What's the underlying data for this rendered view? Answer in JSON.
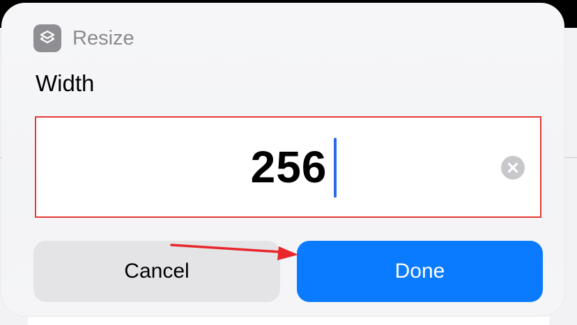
{
  "dialog": {
    "app_icon": "shortcuts-layers-icon",
    "app_name": "Resize",
    "field_title": "Width",
    "input_value": "256",
    "clear_icon": "clear-x-circle-icon",
    "cancel_label": "Cancel",
    "done_label": "Done"
  },
  "annotation": {
    "type": "red-arrow",
    "color": "#e8262b",
    "points_to": "done-button"
  },
  "colors": {
    "accent": "#0a7bff",
    "highlight_border": "#e53935",
    "caret": "#2f6ae6",
    "secondary_text": "#8a8a8e"
  }
}
